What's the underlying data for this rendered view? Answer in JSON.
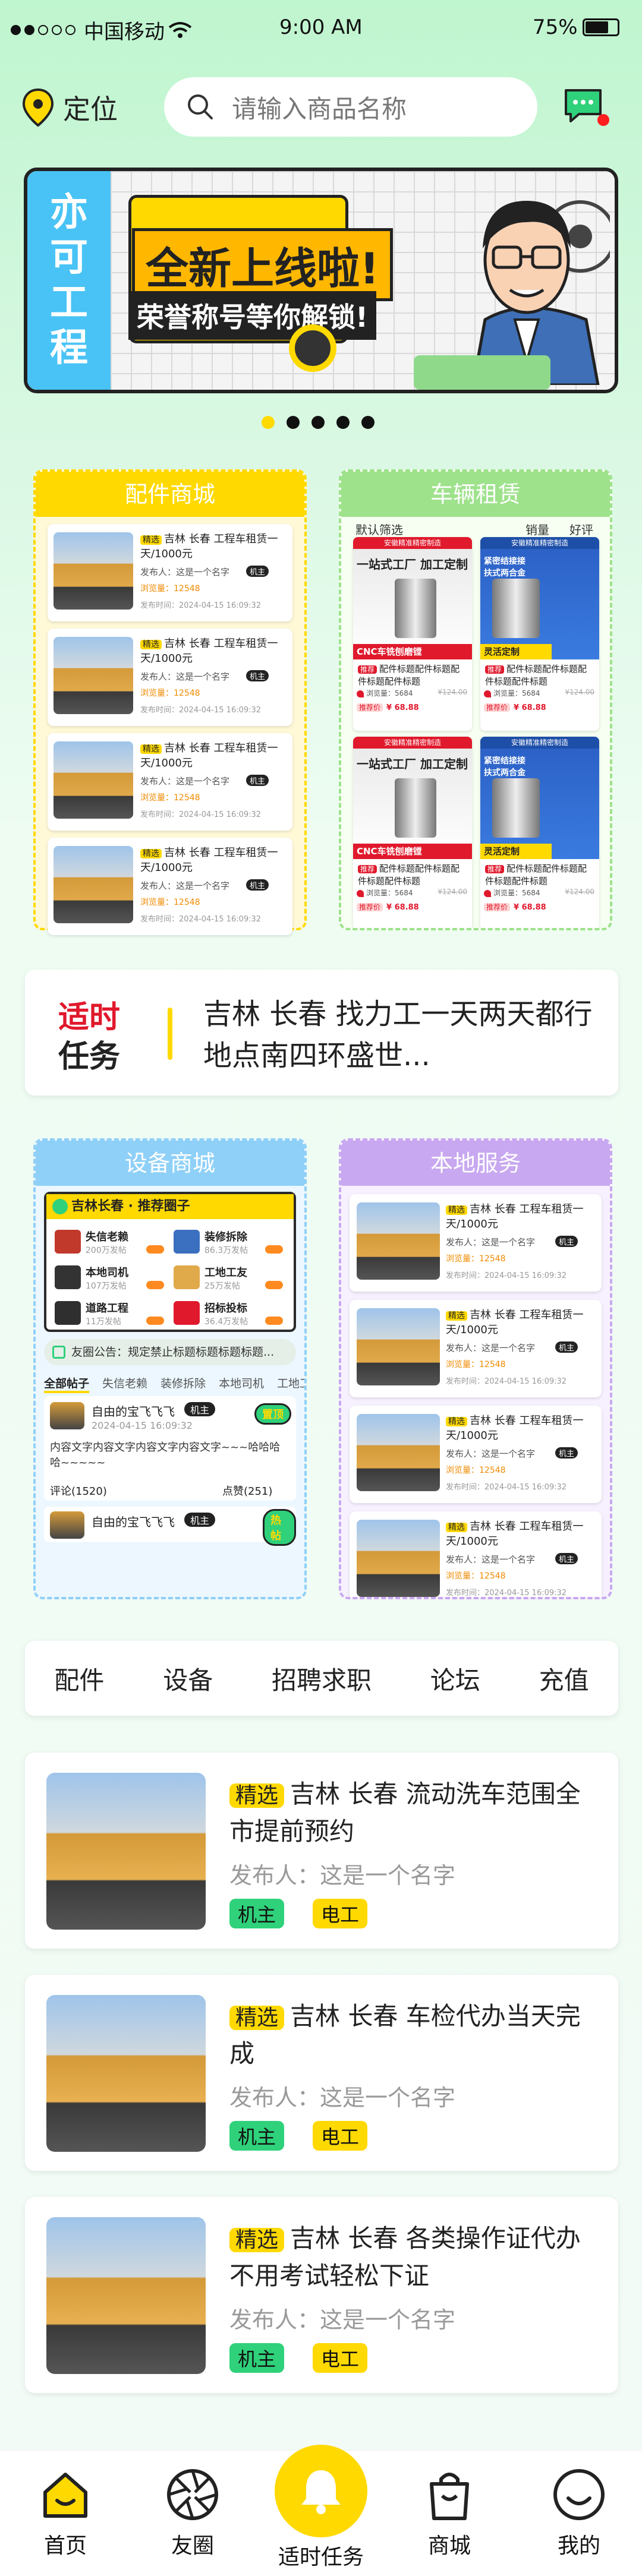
{
  "status": {
    "carrier": "中国移动",
    "time": "9:00 AM",
    "battery": "75%"
  },
  "header": {
    "location_label": "定位",
    "search_placeholder": "请输入商品名称"
  },
  "banner": {
    "brand": [
      "亦",
      "可",
      "工",
      "程"
    ],
    "headline": "全新上线啦!",
    "subline": "荣誉称号等你解锁!"
  },
  "carousel": {
    "count": 5,
    "active": 0
  },
  "sections": {
    "parts": "配件商城",
    "vehicles": "车辆租赁",
    "equipment": "设备商城",
    "local": "本地服务"
  },
  "mini_listing": {
    "tag": "精选",
    "title": "吉林 长春 工程车租赁一天/1000元",
    "publisher": "发布人：这是一个名字",
    "badge": "机主",
    "views": "浏览量：12548",
    "date": "发布时间：2024-04-15 16:09:32"
  },
  "rental": {
    "filter_left": "默认筛选",
    "filter_mid": "销量",
    "filter_right": "好评",
    "card_red": {
      "top": "安徽精准精密制造",
      "head": "一站式工厂 加工定制",
      "foot": "CNC车铣刨磨镗"
    },
    "card_blue": {
      "top": "安徽精准精密制造",
      "head": "紧密结接接\n扶式两合金",
      "foot": "灵活定制"
    },
    "tag": "推荐",
    "title": "配件标题配件标题配件标题配件标题",
    "views": "浏览量：5684",
    "old_price": "¥124.00",
    "sale_label": "推荐价",
    "price": "¥ 68.88"
  },
  "task": {
    "label1": "适时",
    "label2": "任务",
    "text": "吉林 长春 找力工一天两天都行地点南四环盛世..."
  },
  "circle": {
    "title": "吉林长春 · 推荐圈子",
    "items": [
      {
        "name": "失信老赖",
        "sub": "200万发帖"
      },
      {
        "name": "装修拆除",
        "sub": "86.3万发帖"
      },
      {
        "name": "本地司机",
        "sub": "107万发帖"
      },
      {
        "name": "工地工友",
        "sub": "25万发帖"
      },
      {
        "name": "道路工程",
        "sub": "11万发帖"
      },
      {
        "name": "招标投标",
        "sub": "36.4万发帖"
      }
    ],
    "notice": "友圈公告：规定禁止标题标题标题标题...",
    "tabs": [
      "全部帖子",
      "失信老赖",
      "装修拆除",
      "本地司机",
      "工地工"
    ],
    "post_user": "自由的宝飞飞飞",
    "post_badge": "机主",
    "post_sticker": "置顶",
    "post_date": "2024-04-15 16:09:32",
    "post_text": "内容文字内容文字内容文字内容文字~~~哈哈哈哈~~~~~",
    "comments": "评论(1520)",
    "likes": "点赞(251)",
    "post2_sticker": "热帖"
  },
  "quick_nav": [
    "配件",
    "设备",
    "招聘求职",
    "论坛",
    "充值"
  ],
  "listings": [
    {
      "tag": "精选",
      "title": "吉林 长春 流动洗车范围全市提前预约",
      "publisher": "发布人：这是一个名字",
      "badges": [
        "机主",
        "电工"
      ]
    },
    {
      "tag": "精选",
      "title": "吉林 长春 车检代办当天完成",
      "publisher": "发布人：这是一个名字",
      "badges": [
        "机主",
        "电工"
      ]
    },
    {
      "tag": "精选",
      "title": "吉林 长春 各类操作证代办不用考试轻松下证",
      "publisher": "发布人：这是一个名字",
      "badges": [
        "机主",
        "电工"
      ]
    }
  ],
  "tabbar": [
    {
      "label": "首页",
      "icon": "home-icon"
    },
    {
      "label": "友圈",
      "icon": "aperture-icon"
    },
    {
      "label": "适时任务",
      "icon": "bell-icon"
    },
    {
      "label": "商城",
      "icon": "bag-icon"
    },
    {
      "label": "我的",
      "icon": "smile-icon"
    }
  ],
  "colors": {
    "accent": "#ffd900",
    "green": "#2fd17a",
    "red_dot": "#ff1f1f",
    "purple": "#c8a8f0",
    "blue": "#8fd0f8"
  }
}
